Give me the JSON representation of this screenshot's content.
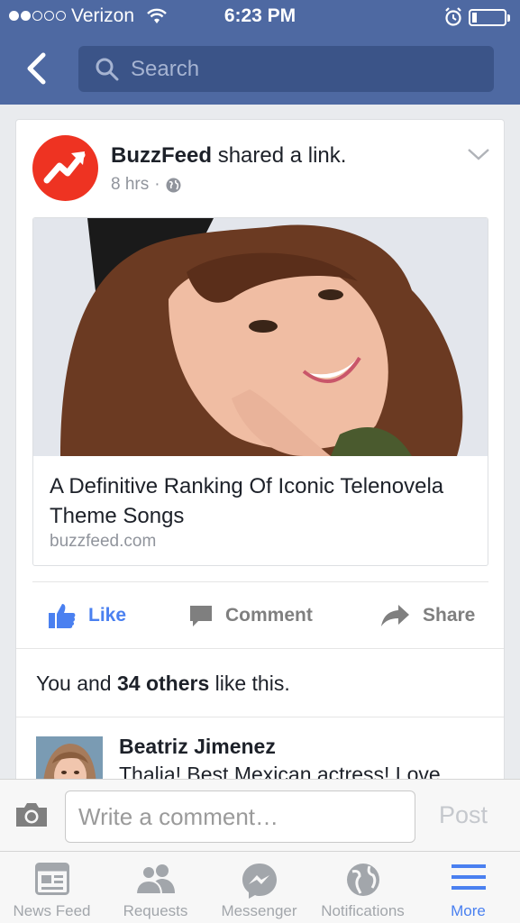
{
  "status_bar": {
    "carrier": "Verizon",
    "time": "6:23 PM",
    "signal_bars": 2,
    "signal_total": 5,
    "battery_level": 0.15
  },
  "nav": {
    "back_icon": "chevron-left-icon",
    "search_placeholder": "Search"
  },
  "post": {
    "poster": "BuzzFeed",
    "action": "shared a link.",
    "age": "8 hrs",
    "separator": "·",
    "privacy_icon": "globe-icon",
    "link": {
      "title": "A Definitive Ranking Of Iconic Telenovela Theme Songs",
      "domain": "buzzfeed.com"
    },
    "actions": {
      "like": "Like",
      "comment": "Comment",
      "share": "Share"
    },
    "likes": {
      "prefix": "You and ",
      "count_text": "34 others",
      "suffix": " like this."
    },
    "comment": {
      "author": "Beatriz Jimenez",
      "text": "Thalia! Best Mexican actress! Love"
    }
  },
  "composer": {
    "placeholder": "Write a comment…",
    "post_label": "Post"
  },
  "tabs": [
    {
      "label": "News Feed",
      "icon": "news-feed-icon"
    },
    {
      "label": "Requests",
      "icon": "friend-requests-icon"
    },
    {
      "label": "Messenger",
      "icon": "messenger-icon"
    },
    {
      "label": "Notifications",
      "icon": "globe-icon"
    },
    {
      "label": "More",
      "icon": "menu-icon",
      "active": true
    }
  ],
  "colors": {
    "header": "#4e69a2",
    "accent": "#4a80f0",
    "buzzfeed_red": "#ee3322"
  }
}
